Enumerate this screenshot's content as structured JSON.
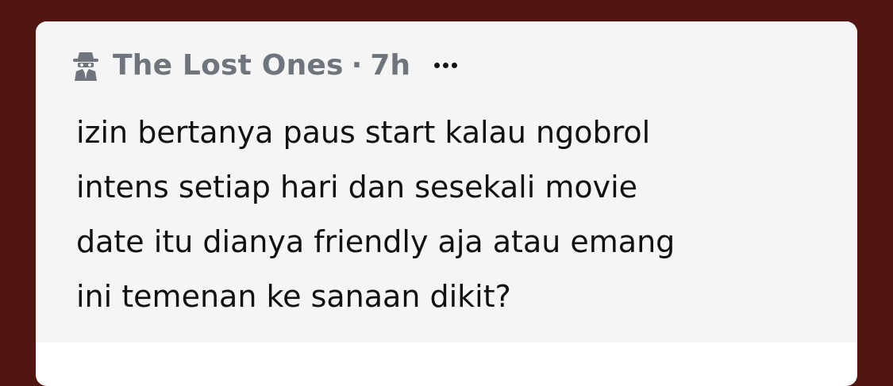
{
  "post": {
    "author": "The Lost Ones",
    "separator": "·",
    "time": "7h",
    "icon": "spy-icon",
    "more_icon": "more-icon",
    "content_lines": [
      "izin bertanya paus start kalau ngobrol",
      "intens setiap hari dan sesekali movie",
      "date itu dianya friendly aja atau emang",
      "ini temenan ke sanaan dikit?"
    ]
  },
  "colors": {
    "background": "#511512",
    "card": "#f5f5f5",
    "meta_text": "#6e757c",
    "body_text": "#111111"
  }
}
